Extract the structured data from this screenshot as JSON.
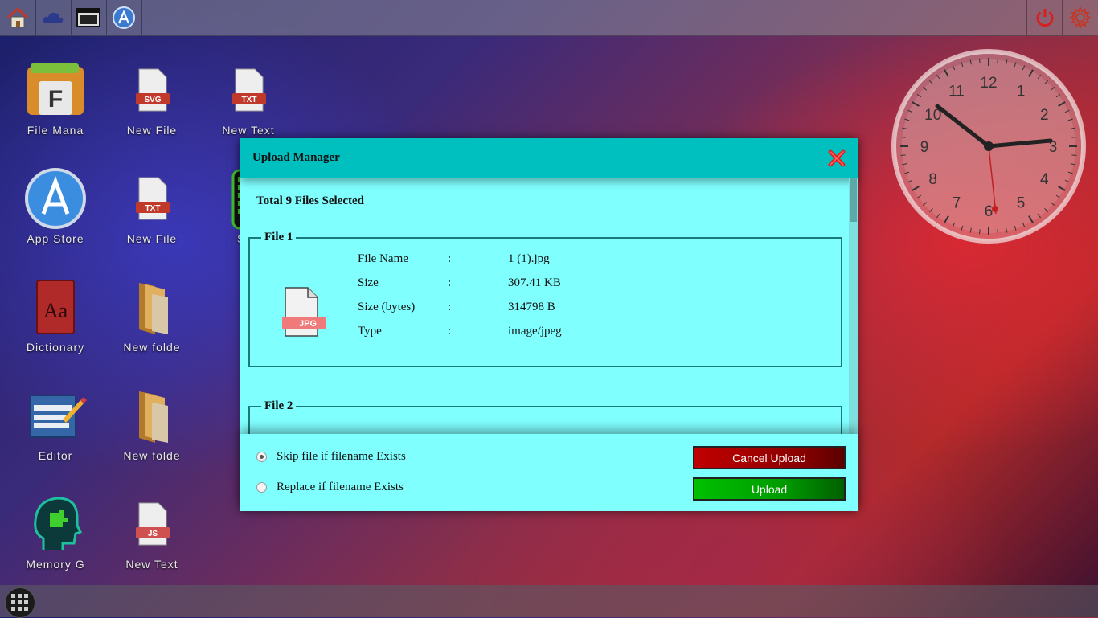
{
  "desktop": {
    "icons": [
      {
        "label": "File Mana",
        "icon": "file-manager-icon"
      },
      {
        "label": "New File",
        "icon": "svg-file-icon",
        "badge": "SVG"
      },
      {
        "label": "New Text",
        "icon": "txt-file-icon",
        "badge": "TXT"
      },
      {
        "label": "App Store",
        "icon": "app-store-icon"
      },
      {
        "label": "New File",
        "icon": "txt-file-icon",
        "badge": "TXT"
      },
      {
        "label": "Sna",
        "icon": "snake-game-icon"
      },
      {
        "label": "Dictionary",
        "icon": "dictionary-icon",
        "glyph": "Aa"
      },
      {
        "label": "New folde",
        "icon": "folder-icon"
      },
      {
        "label": "Editor",
        "icon": "editor-icon"
      },
      {
        "label": "New folde",
        "icon": "folder-icon"
      },
      {
        "label": "Memory G",
        "icon": "memory-game-icon"
      },
      {
        "label": "New Text",
        "icon": "js-file-icon",
        "badge": "JS"
      }
    ],
    "file_manager_glyph": "F"
  },
  "clock": {
    "numbers": [
      "12",
      "1",
      "2",
      "3",
      "4",
      "5",
      "6",
      "7",
      "8",
      "9",
      "10",
      "11"
    ],
    "time": "10:15"
  },
  "upload_manager": {
    "title": "Upload Manager",
    "summary": "Total 9 Files Selected",
    "files": [
      {
        "legend": "File 1",
        "icon_badge": "JPG",
        "rows": [
          {
            "key": "File Name",
            "sep": ":",
            "value": "1 (1).jpg"
          },
          {
            "key": "Size",
            "sep": ":",
            "value": "307.41 KB"
          },
          {
            "key": "Size (bytes)",
            "sep": ":",
            "value": "314798 B"
          },
          {
            "key": "Type",
            "sep": ":",
            "value": "image/jpeg"
          }
        ]
      },
      {
        "legend": "File 2"
      }
    ],
    "options": [
      {
        "label": "Skip file if filename Exists",
        "selected": true
      },
      {
        "label": "Replace if filename Exists",
        "selected": false
      }
    ],
    "cancel_label": "Cancel Upload",
    "upload_label": "Upload"
  },
  "colors": {
    "modal_bg": "#80ffff",
    "header_bg": "#00bfbf",
    "cancel": "#c00000",
    "upload": "#00c000",
    "power": "#d62020"
  }
}
